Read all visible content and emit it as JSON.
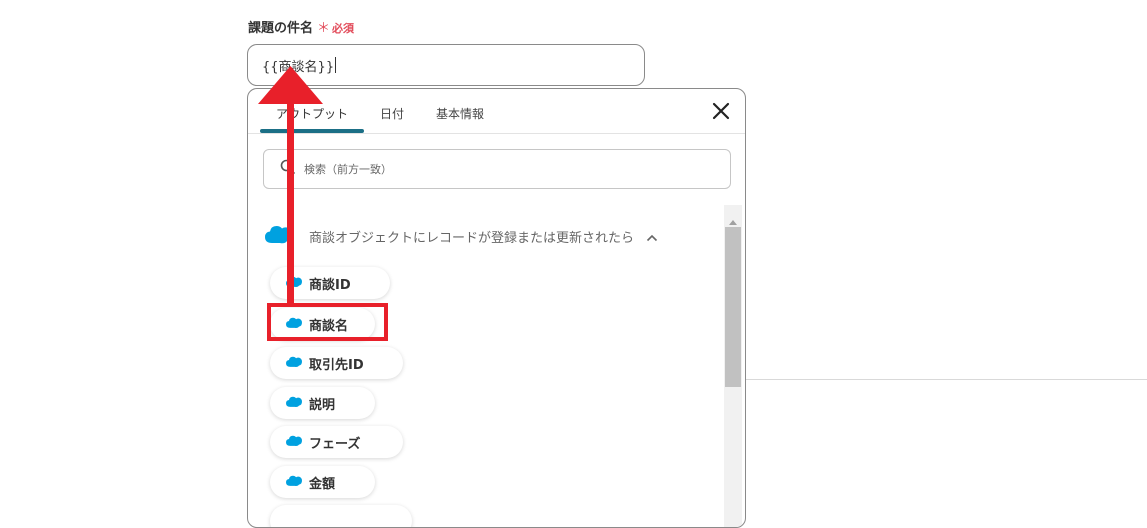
{
  "field": {
    "label": "課題の件名",
    "required_mark": "＊",
    "required_text": "必須",
    "value": "{{商談名}}"
  },
  "panel": {
    "tabs": [
      {
        "label": "アウトプット",
        "active": true
      },
      {
        "label": "日付",
        "active": false
      },
      {
        "label": "基本情報",
        "active": false
      }
    ],
    "search_placeholder": "検索（前方一致）",
    "group": {
      "title": "商談オブジェクトにレコードが登録または更新されたら",
      "icon": "salesforce-cloud-icon",
      "expanded": true
    },
    "items": [
      {
        "label": "商談ID"
      },
      {
        "label": "商談名",
        "highlighted": true
      },
      {
        "label": "取引先ID"
      },
      {
        "label": "説明"
      },
      {
        "label": "フェーズ"
      },
      {
        "label": "金額"
      }
    ]
  },
  "colors": {
    "accent": "#1b6f86",
    "required": "#e24b5a",
    "annotation": "#e8202a",
    "salesforce": "#00a1e0"
  }
}
